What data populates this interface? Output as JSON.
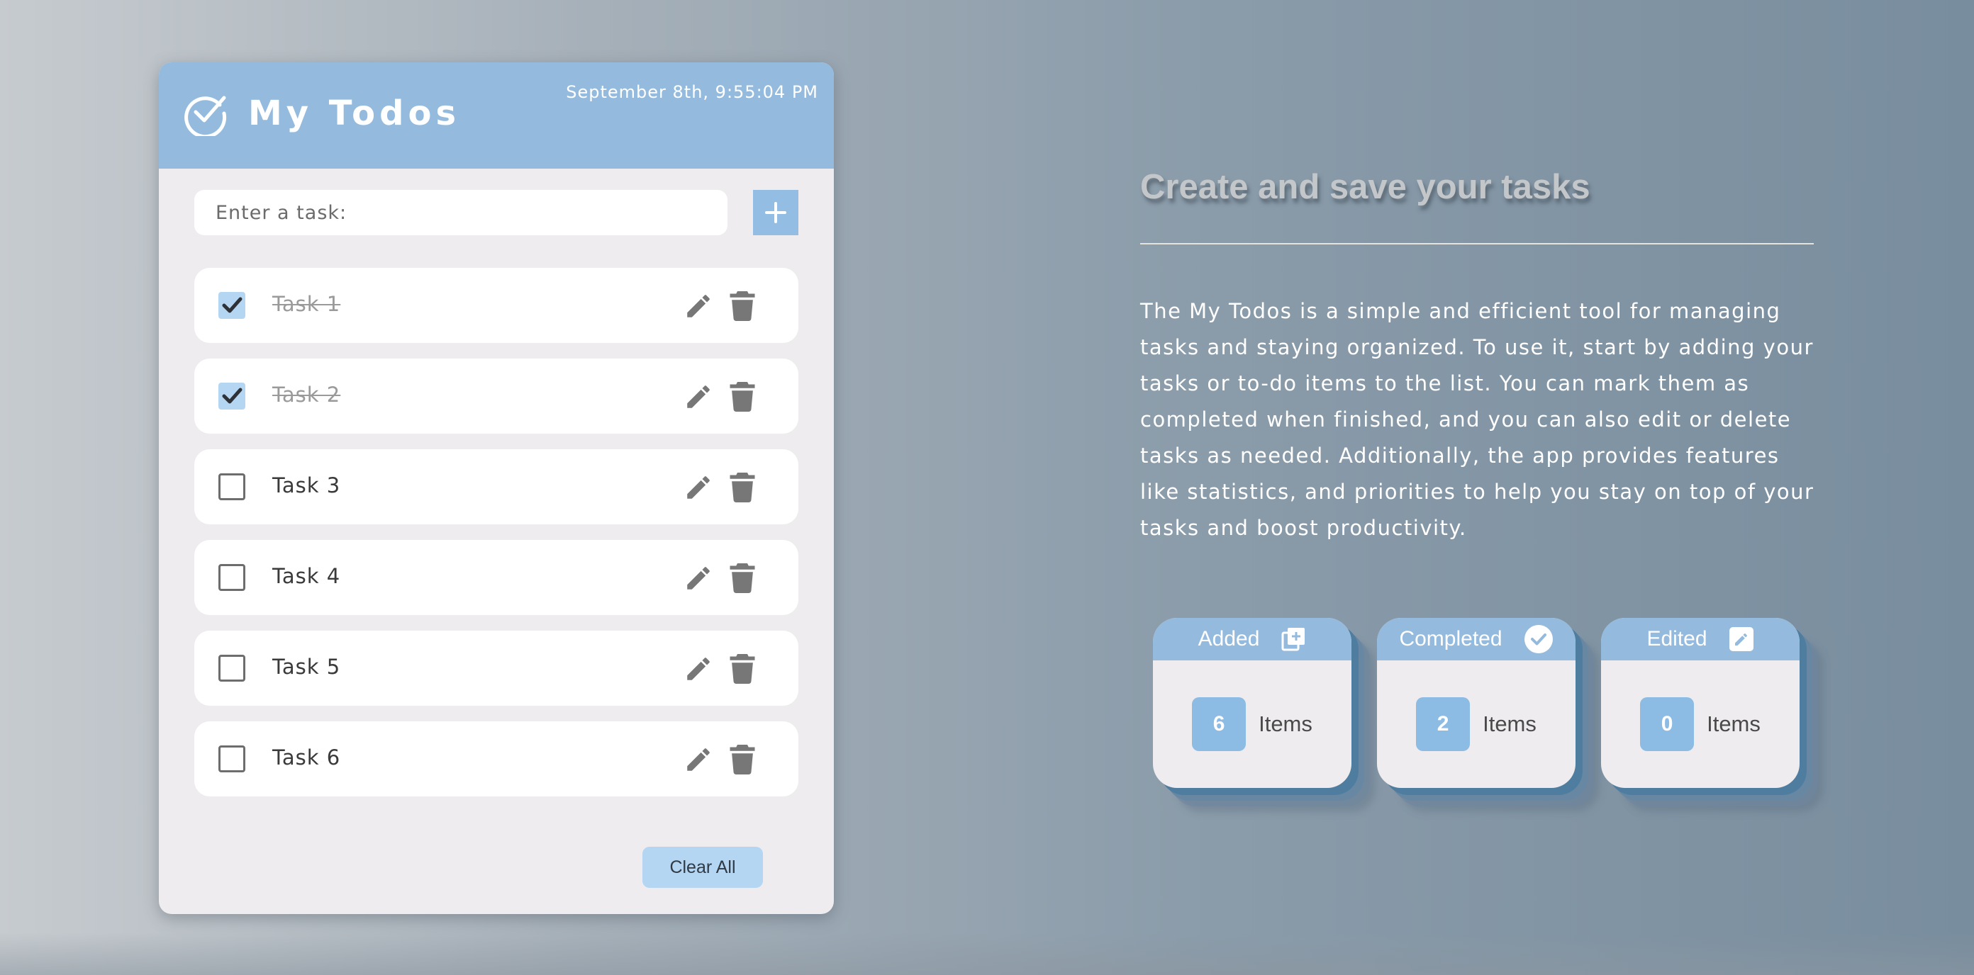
{
  "app": {
    "title": "My Todos",
    "datetime": "September 8th, 9:55:04 PM"
  },
  "input": {
    "placeholder": "Enter a task:",
    "value": ""
  },
  "tasks": [
    {
      "label": "Task 1",
      "completed": true
    },
    {
      "label": "Task 2",
      "completed": true
    },
    {
      "label": "Task 3",
      "completed": false
    },
    {
      "label": "Task 4",
      "completed": false
    },
    {
      "label": "Task 5",
      "completed": false
    },
    {
      "label": "Task 6",
      "completed": false
    }
  ],
  "clear_all_label": "Clear All",
  "info": {
    "title": "Create and save your tasks",
    "description": "The My Todos is a simple and efficient tool for managing tasks and staying organized. To use it, start by adding your tasks or to-do items to the list. You can mark them as completed when finished, and you can also edit or delete tasks as needed. Additionally, the app provides features like statistics, and priorities to help you stay on top of your tasks and boost productivity."
  },
  "stats": [
    {
      "label": "Added",
      "count": "6",
      "unit": "Items",
      "icon": "add-copy-icon"
    },
    {
      "label": "Completed",
      "count": "2",
      "unit": "Items",
      "icon": "check-circle-icon"
    },
    {
      "label": "Edited",
      "count": "0",
      "unit": "Items",
      "icon": "edit-square-icon"
    }
  ],
  "colors": {
    "accent": "#94bbde",
    "card_bg": "#eeecef",
    "checkbox_checked": "#b4d6f3",
    "stat_count_bg": "#8cbbe4"
  }
}
